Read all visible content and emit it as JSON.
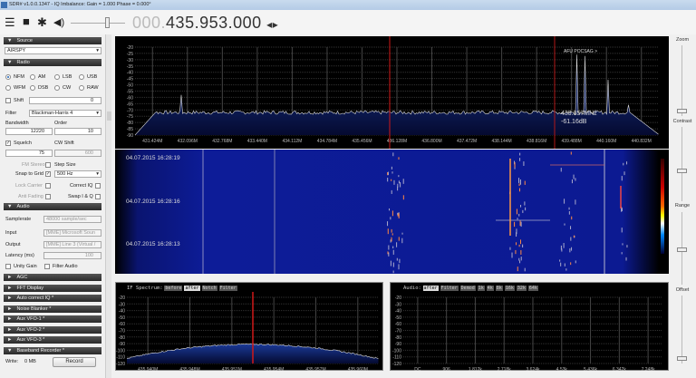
{
  "window": {
    "title": "SDR# v1.0.0.1347 - IQ Imbalance: Gain = 1.000 Phase = 0.000°"
  },
  "toolbar": {
    "menu_icon": "hamburger-icon",
    "stop_icon": "stop-icon",
    "settings_icon": "gear-icon",
    "volume_icon": "speaker-icon",
    "freq_prefix": "000.",
    "frequency": "435.953.000",
    "tune_arrows": "◂▸"
  },
  "source": {
    "header": "Source",
    "device": "AIRSPY"
  },
  "radio": {
    "header": "Radio",
    "modes": [
      "NFM",
      "AM",
      "LSB",
      "USB",
      "WFM",
      "DSB",
      "CW",
      "RAW"
    ],
    "selected_mode": "NFM",
    "shift_label": "Shift",
    "shift_value": "0",
    "filter_label": "Filter",
    "filter_value": "Blackman-Harris 4",
    "bandwidth_label": "Bandwidth",
    "bandwidth_value": "12220",
    "order_label": "Order",
    "order_value": "10",
    "squelch_label": "Squelch",
    "squelch_value": "75",
    "cw_shift_label": "CW Shift",
    "cw_shift_value": "600",
    "fm_stereo_label": "FM Stereo",
    "step_size_label": "Step Size",
    "snap_label": "Snap to Grid",
    "step_value": "500 Hz",
    "lock_carrier_label": "Lock Carrier",
    "correct_iq_label": "Correct IQ",
    "anti_fading_label": "Anti Fading",
    "swap_iq_label": "Swap I & Q"
  },
  "audio": {
    "header": "Audio",
    "samplerate_label": "Samplerate",
    "samplerate_value": "48000 sample/sec",
    "input_label": "Input",
    "input_value": "[MME] Microsoft Soun",
    "output_label": "Output",
    "output_value": "[MME] Line 3 (Virtual /",
    "latency_label": "Latency (ms)",
    "latency_value": "100",
    "unity_gain_label": "Unity Gain",
    "filter_audio_label": "Filter Audio"
  },
  "collapsed_panels": [
    "AGC",
    "FFT Display",
    "Auto correct IQ *",
    "Noise Blanker *",
    "Aux VFO-1 *",
    "Aux VFO-2 *",
    "Aux VFO-3 *"
  ],
  "recorder": {
    "header": "Baseband Recorder *",
    "write_label": "Write:",
    "write_value": "0 MB",
    "record_button": "Record"
  },
  "spectrum": {
    "db_ticks": [
      "-20",
      "-25",
      "-30",
      "-35",
      "-40",
      "-45",
      "-50",
      "-55",
      "-60",
      "-65",
      "-70",
      "-75",
      "-80",
      "-85",
      "-90"
    ],
    "freq_ticks": [
      "431.424M",
      "432.096M",
      "432.768M",
      "433.440M",
      "434.112M",
      "434.784M",
      "435.456M",
      "436.128M",
      "436.800M",
      "437.472M",
      "438.144M",
      "438.816M",
      "439.488M",
      "440.160M",
      "440.832M"
    ],
    "bookmark": "AFU POCSAG >",
    "cursor_freq": "439.857MHz",
    "cursor_db": "-61.16dB"
  },
  "waterfall": {
    "timestamps": [
      "04.07.2015 16:28:19",
      "04.07.2015 16:28:16",
      "04.07.2015 16:28:13"
    ]
  },
  "if_spectrum": {
    "label": "IF Spectrum:",
    "buttons": [
      "before",
      "after",
      "Notch",
      "Filter"
    ],
    "active": "after",
    "db_ticks": [
      "-20",
      "-30",
      "-40",
      "-50",
      "-60",
      "-70",
      "-80",
      "-90",
      "-100",
      "-110",
      "-120"
    ],
    "freq_ticks": [
      "435.940M",
      "435.948M",
      "435.951M",
      "435.954M",
      "435.957M",
      "435.960M"
    ]
  },
  "audio_spectrum": {
    "label": "Audio:",
    "buttons": [
      "after",
      "Filter",
      "Demod",
      "1k",
      "4k",
      "8k",
      "16k",
      "32k",
      "64k"
    ],
    "active": "after",
    "db_ticks": [
      "-20",
      "-30",
      "-40",
      "-50",
      "-60",
      "-70",
      "-80",
      "-90",
      "-100",
      "-110",
      "-120"
    ],
    "freq_ticks": [
      "DC",
      "906",
      "1.812k",
      "2.718k",
      "3.624k",
      "4.53k",
      "5.436k",
      "6.342k",
      "7.248k"
    ]
  },
  "right_sliders": {
    "zoom": "Zoom",
    "contrast": "Contrast",
    "range": "Range",
    "offset": "Offset"
  },
  "colors": {
    "spectrum_fill": "#0d2a7a",
    "waterfall_bg": "#0a1a8a",
    "cursor": "#d01818",
    "panel_header": "#333333"
  }
}
